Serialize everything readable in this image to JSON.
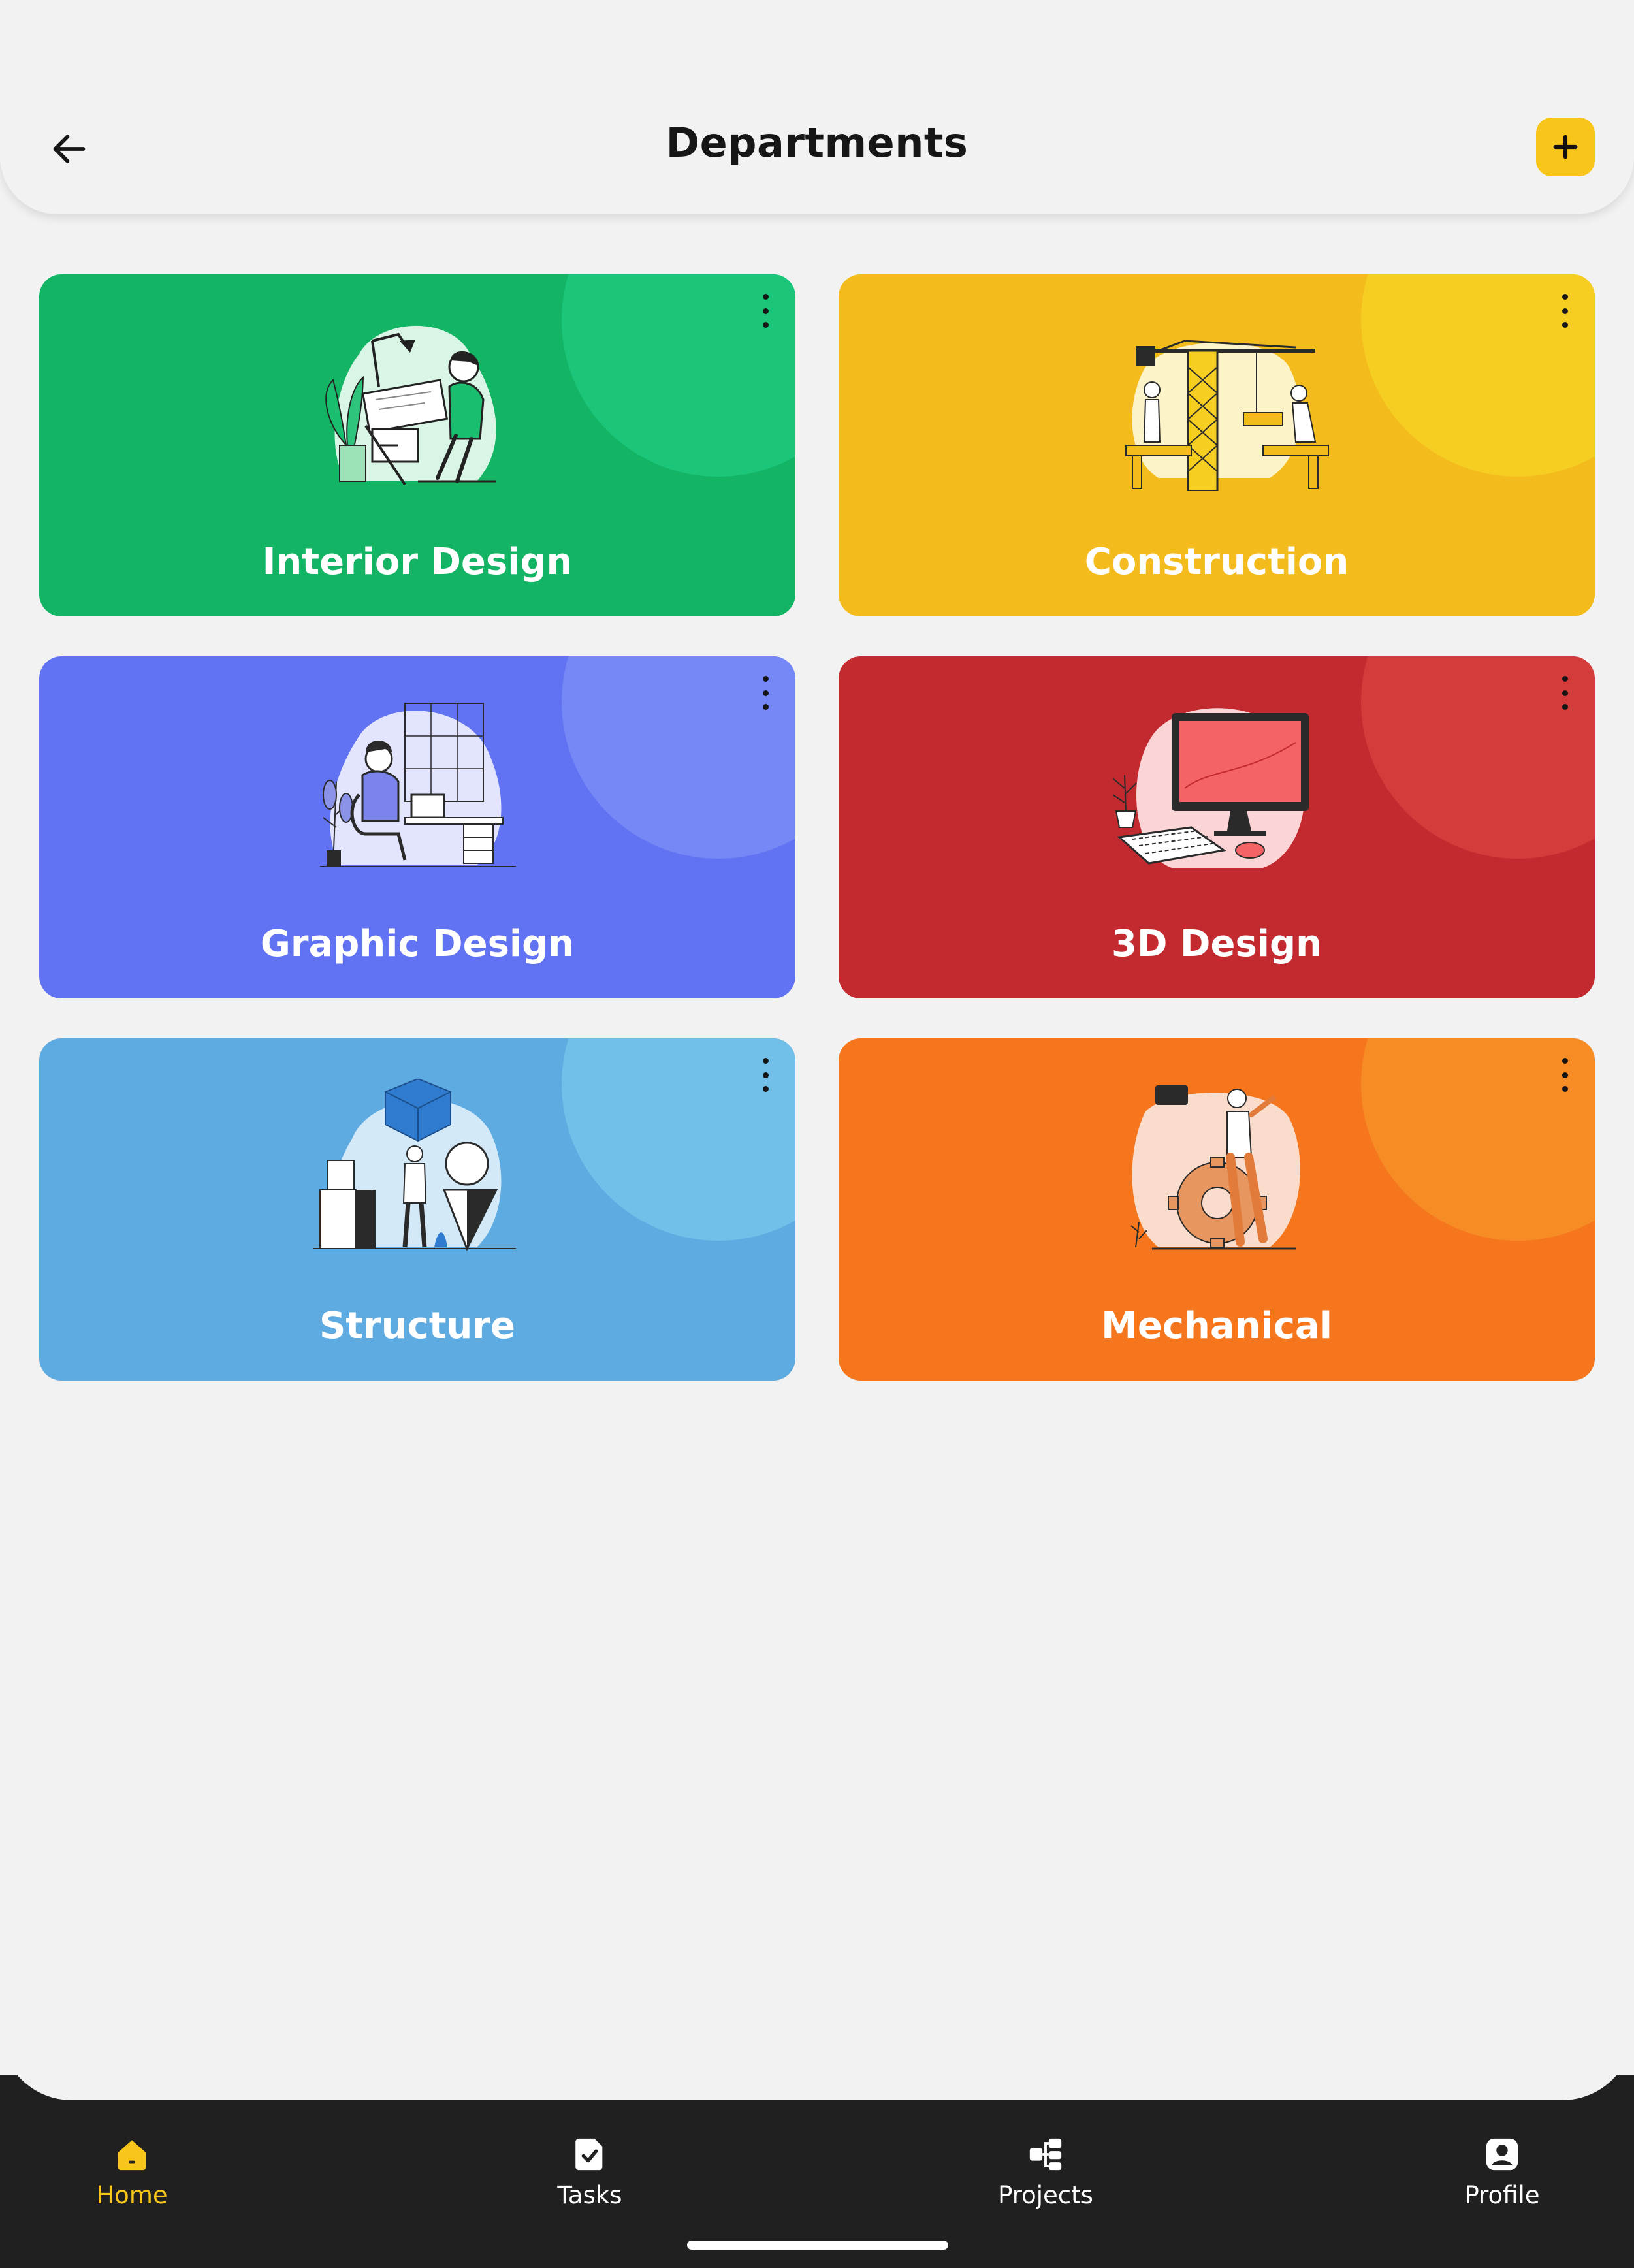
{
  "header": {
    "title": "Departments",
    "back_icon": "arrow-left-icon",
    "add_icon": "plus-icon",
    "accent": "#f8c51b"
  },
  "departments": [
    {
      "name": "Interior Design",
      "color": "#13b564"
    },
    {
      "name": "Construction",
      "color": "#f3bb1c"
    },
    {
      "name": "Graphic Design",
      "color": "#6173f2"
    },
    {
      "name": "3D Design",
      "color": "#c32a2f"
    },
    {
      "name": "Structure",
      "color": "#5eabe2"
    },
    {
      "name": "Mechanical",
      "color": "#f5761c"
    }
  ],
  "nav": {
    "items": [
      {
        "label": "Home",
        "icon": "home-icon",
        "active": true
      },
      {
        "label": "Tasks",
        "icon": "task-check-icon",
        "active": false
      },
      {
        "label": "Projects",
        "icon": "projects-hierarchy-icon",
        "active": false
      },
      {
        "label": "Profile",
        "icon": "profile-icon",
        "active": false
      }
    ]
  }
}
